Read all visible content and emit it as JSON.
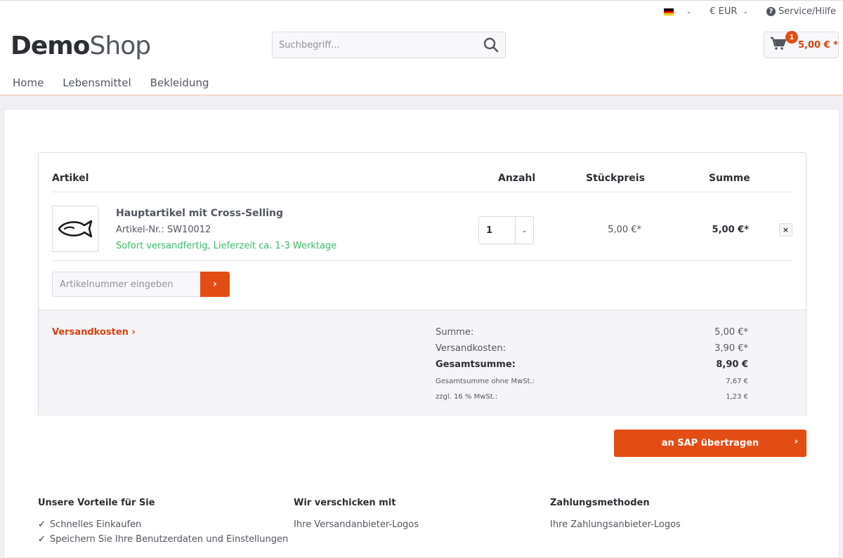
{
  "topbar": {
    "currency": "€ EUR",
    "help": "Service/Hilfe"
  },
  "logo": {
    "part1": "Demo",
    "part2": "Shop"
  },
  "search": {
    "placeholder": "Suchbegriff..."
  },
  "cart_button": {
    "badge_count": "1",
    "amount": "5,00 € *"
  },
  "nav": {
    "items": [
      "Home",
      "Lebensmittel",
      "Bekleidung"
    ]
  },
  "table": {
    "headers": {
      "article": "Artikel",
      "quantity": "Anzahl",
      "unit_price": "Stückpreis",
      "sum": "Summe"
    },
    "row": {
      "name": "Hauptartikel mit Cross-Selling",
      "sku": "Artikel-Nr.: SW10012",
      "delivery": "Sofort versandfertig, Lieferzeit ca. 1-3 Werktage",
      "quantity": "1",
      "unit_price": "5,00 €*",
      "sum": "5,00 €*",
      "remove": "×"
    }
  },
  "add_article": {
    "placeholder": "Artikelnummer eingeben",
    "button": "›"
  },
  "summary": {
    "shipping_link": "Versandkosten ›",
    "rows": [
      {
        "label": "Summe:",
        "value": "5,00 €*"
      },
      {
        "label": "Versandkosten:",
        "value": "3,90 €*"
      },
      {
        "label": "Gesamtsumme:",
        "value": "8,90 €"
      },
      {
        "label": "Gesamtsumme ohne MwSt.:",
        "value": "7,67 €"
      },
      {
        "label": "zzgl. 16 % MwSt.:",
        "value": "1,23 €"
      }
    ]
  },
  "sap_button": {
    "label": "an SAP übertragen",
    "chev": "›"
  },
  "footer": {
    "col1": {
      "title": "Unsere Vorteile für Sie",
      "items": [
        "Schnelles Einkaufen",
        "Speichern Sie Ihre Benutzerdaten und Einstellungen"
      ]
    },
    "col2": {
      "title": "Wir verschicken mit",
      "items": [
        "Ihre Versandanbieter-Logos"
      ]
    },
    "col3": {
      "title": "Zahlungsmethoden",
      "items": [
        "Ihre Zahlungsanbieter-Logos"
      ]
    }
  },
  "colors": {
    "accent": "#e24d15",
    "success": "#3cb96a",
    "text": "#52575e"
  }
}
